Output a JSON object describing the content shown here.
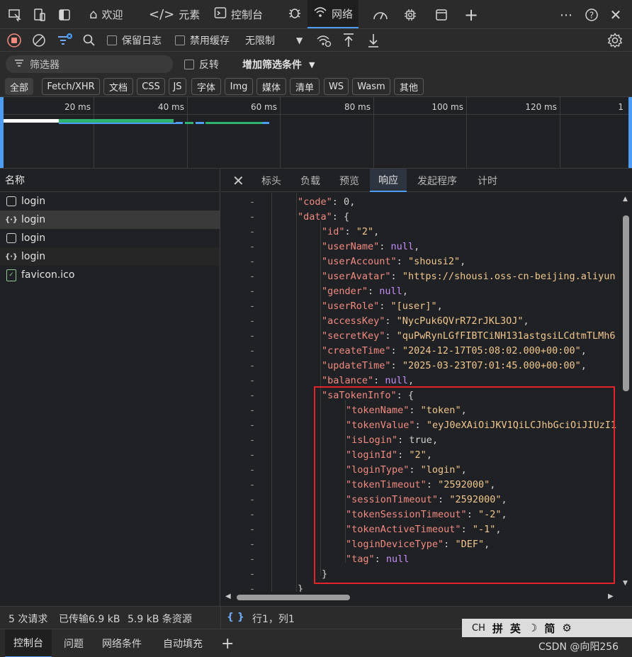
{
  "tabs": {
    "welcome": "欢迎",
    "elements": "元素",
    "console": "控制台",
    "network": "网络"
  },
  "toolbar": {
    "preserve_log": "保留日志",
    "disable_cache": "禁用缓存",
    "throttle": "无限制"
  },
  "filter": {
    "placeholder": "筛选器",
    "invert": "反转",
    "more_filters": "增加筛选条件"
  },
  "types": [
    "全部",
    "Fetch/XHR",
    "文档",
    "CSS",
    "JS",
    "字体",
    "Img",
    "媒体",
    "清单",
    "WS",
    "Wasm",
    "其他"
  ],
  "timeline_labels": [
    "20 ms",
    "40 ms",
    "60 ms",
    "80 ms",
    "100 ms",
    "120 ms",
    "1"
  ],
  "requests": {
    "header": "名称",
    "items": [
      "login",
      "login",
      "login",
      "login",
      "favicon.ico"
    ]
  },
  "detail_tabs": [
    "标头",
    "负载",
    "预览",
    "响应",
    "发起程序",
    "计时"
  ],
  "response": {
    "code_val": "0",
    "id_val": "\"2\"",
    "userName_val": "null",
    "userAccount_val": "\"shousi2\"",
    "userAvatar_val": "\"https://shousi.oss-cn-beijing.aliyun",
    "gender_val": "null",
    "userRole_val": "\"[user]\"",
    "accessKey_val": "\"NycPuk6QVrR72rJKL3OJ\"",
    "secretKey_val": "\"quPwRynLGfFIBTCiNH131astgsiLCdtmTLMh6",
    "createTime_val": "\"2024-12-17T05:08:02.000+00:00\"",
    "updateTime_val": "\"2025-03-23T07:01:45.000+00:00\"",
    "balance_val": "null",
    "tokenName_val": "\"token\"",
    "tokenValue_val": "\"eyJ0eXAiOiJKV1QiLCJhbGciOiJIUzI1",
    "isLogin_val": "true",
    "loginId_val": "\"2\"",
    "loginType_val": "\"login\"",
    "tokenTimeout_val": "\"2592000\"",
    "sessionTimeout_val": "\"2592000\"",
    "tokenSessionTimeout_val": "\"-2\"",
    "tokenActiveTimeout_val": "\"-1\"",
    "loginDeviceType_val": "\"DEF\"",
    "tag_val": "null"
  },
  "status": {
    "requests": "5 次请求",
    "transferred": "已传输6.9 kB",
    "resources": "5.9 kB 条资源",
    "cursor": "行1，列1"
  },
  "drawer_tabs": [
    "控制台",
    "问题",
    "网络条件",
    "自动填充"
  ],
  "ime": [
    "CH",
    "拼",
    "英",
    "简"
  ],
  "watermark": "CSDN @向阳256"
}
